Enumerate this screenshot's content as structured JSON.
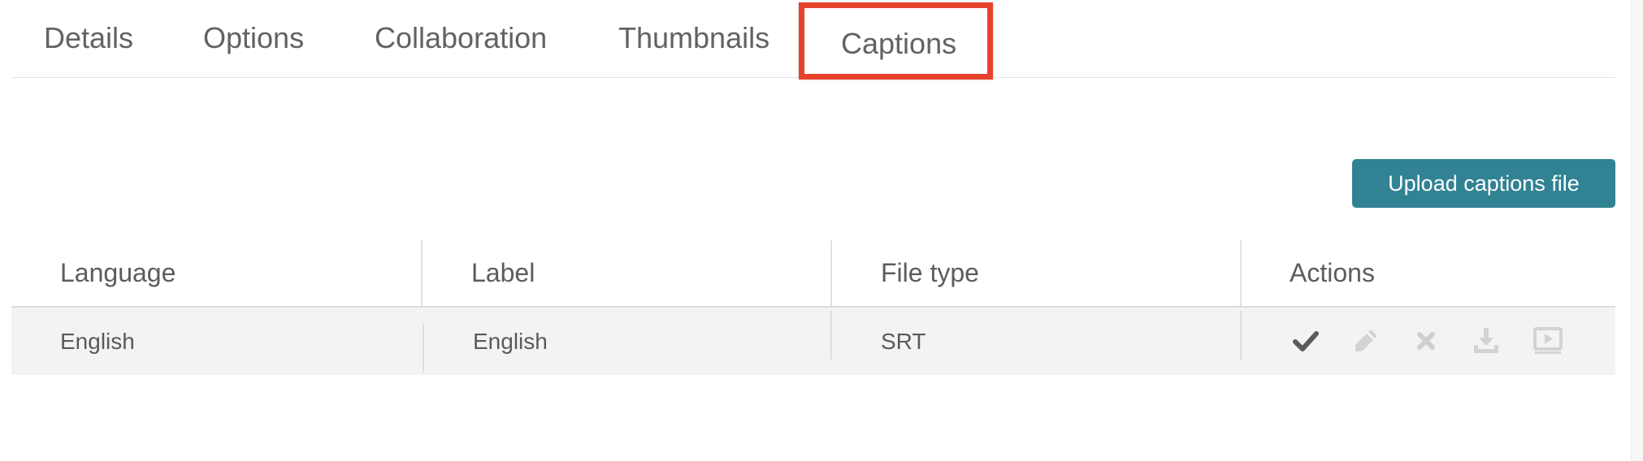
{
  "tabs": [
    {
      "label": "Details"
    },
    {
      "label": "Options"
    },
    {
      "label": "Collaboration"
    },
    {
      "label": "Thumbnails"
    },
    {
      "label": "Captions",
      "active": true
    }
  ],
  "highlight_color": "#e8412c",
  "upload_button": {
    "label": "Upload captions file",
    "color": "#318293"
  },
  "captions_table": {
    "columns": [
      "Language",
      "Label",
      "File type",
      "Actions"
    ],
    "rows": [
      {
        "language": "English",
        "label": "English",
        "file_type": "SRT",
        "actions": [
          {
            "icon": "check-icon",
            "enabled": true
          },
          {
            "icon": "pencil-icon",
            "enabled": false
          },
          {
            "icon": "close-icon",
            "enabled": false
          },
          {
            "icon": "download-icon",
            "enabled": false
          },
          {
            "icon": "video-preview-icon",
            "enabled": false
          }
        ]
      }
    ]
  }
}
